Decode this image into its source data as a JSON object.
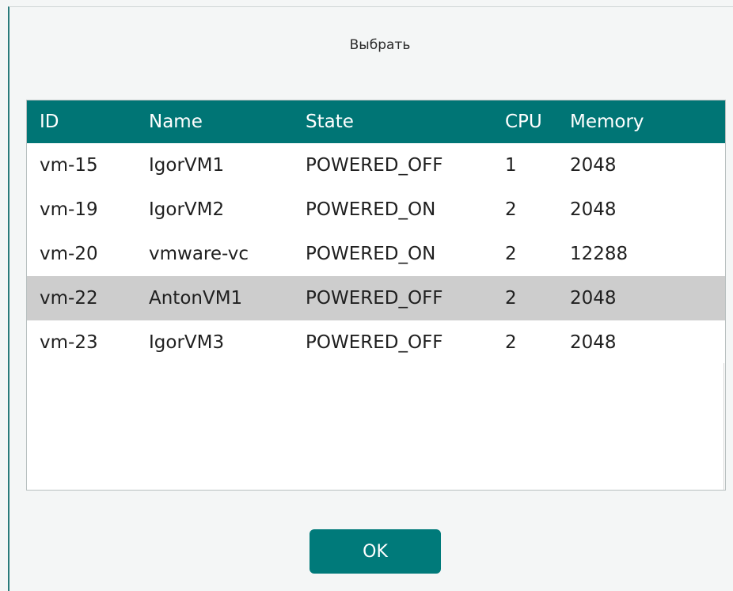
{
  "dialog": {
    "title": "Выбрать",
    "ok_label": "OK"
  },
  "table": {
    "columns": [
      "ID",
      "Name",
      "State",
      "CPU",
      "Memory"
    ],
    "rows": [
      {
        "id": "vm-15",
        "name": "IgorVM1",
        "state": "POWERED_OFF",
        "cpu": "1",
        "memory": "2048"
      },
      {
        "id": "vm-19",
        "name": "IgorVM2",
        "state": "POWERED_ON",
        "cpu": "2",
        "memory": "2048"
      },
      {
        "id": "vm-20",
        "name": "vmware-vc",
        "state": "POWERED_ON",
        "cpu": "2",
        "memory": "12288"
      },
      {
        "id": "vm-22",
        "name": "AntonVM1",
        "state": "POWERED_OFF",
        "cpu": "2",
        "memory": "2048",
        "selected": true
      },
      {
        "id": "vm-23",
        "name": "IgorVM3",
        "state": "POWERED_OFF",
        "cpu": "2",
        "memory": "2048"
      }
    ]
  },
  "colors": {
    "header_bg": "#007575",
    "accent": "#007a7a",
    "selected_row": "#cdcdcd"
  }
}
